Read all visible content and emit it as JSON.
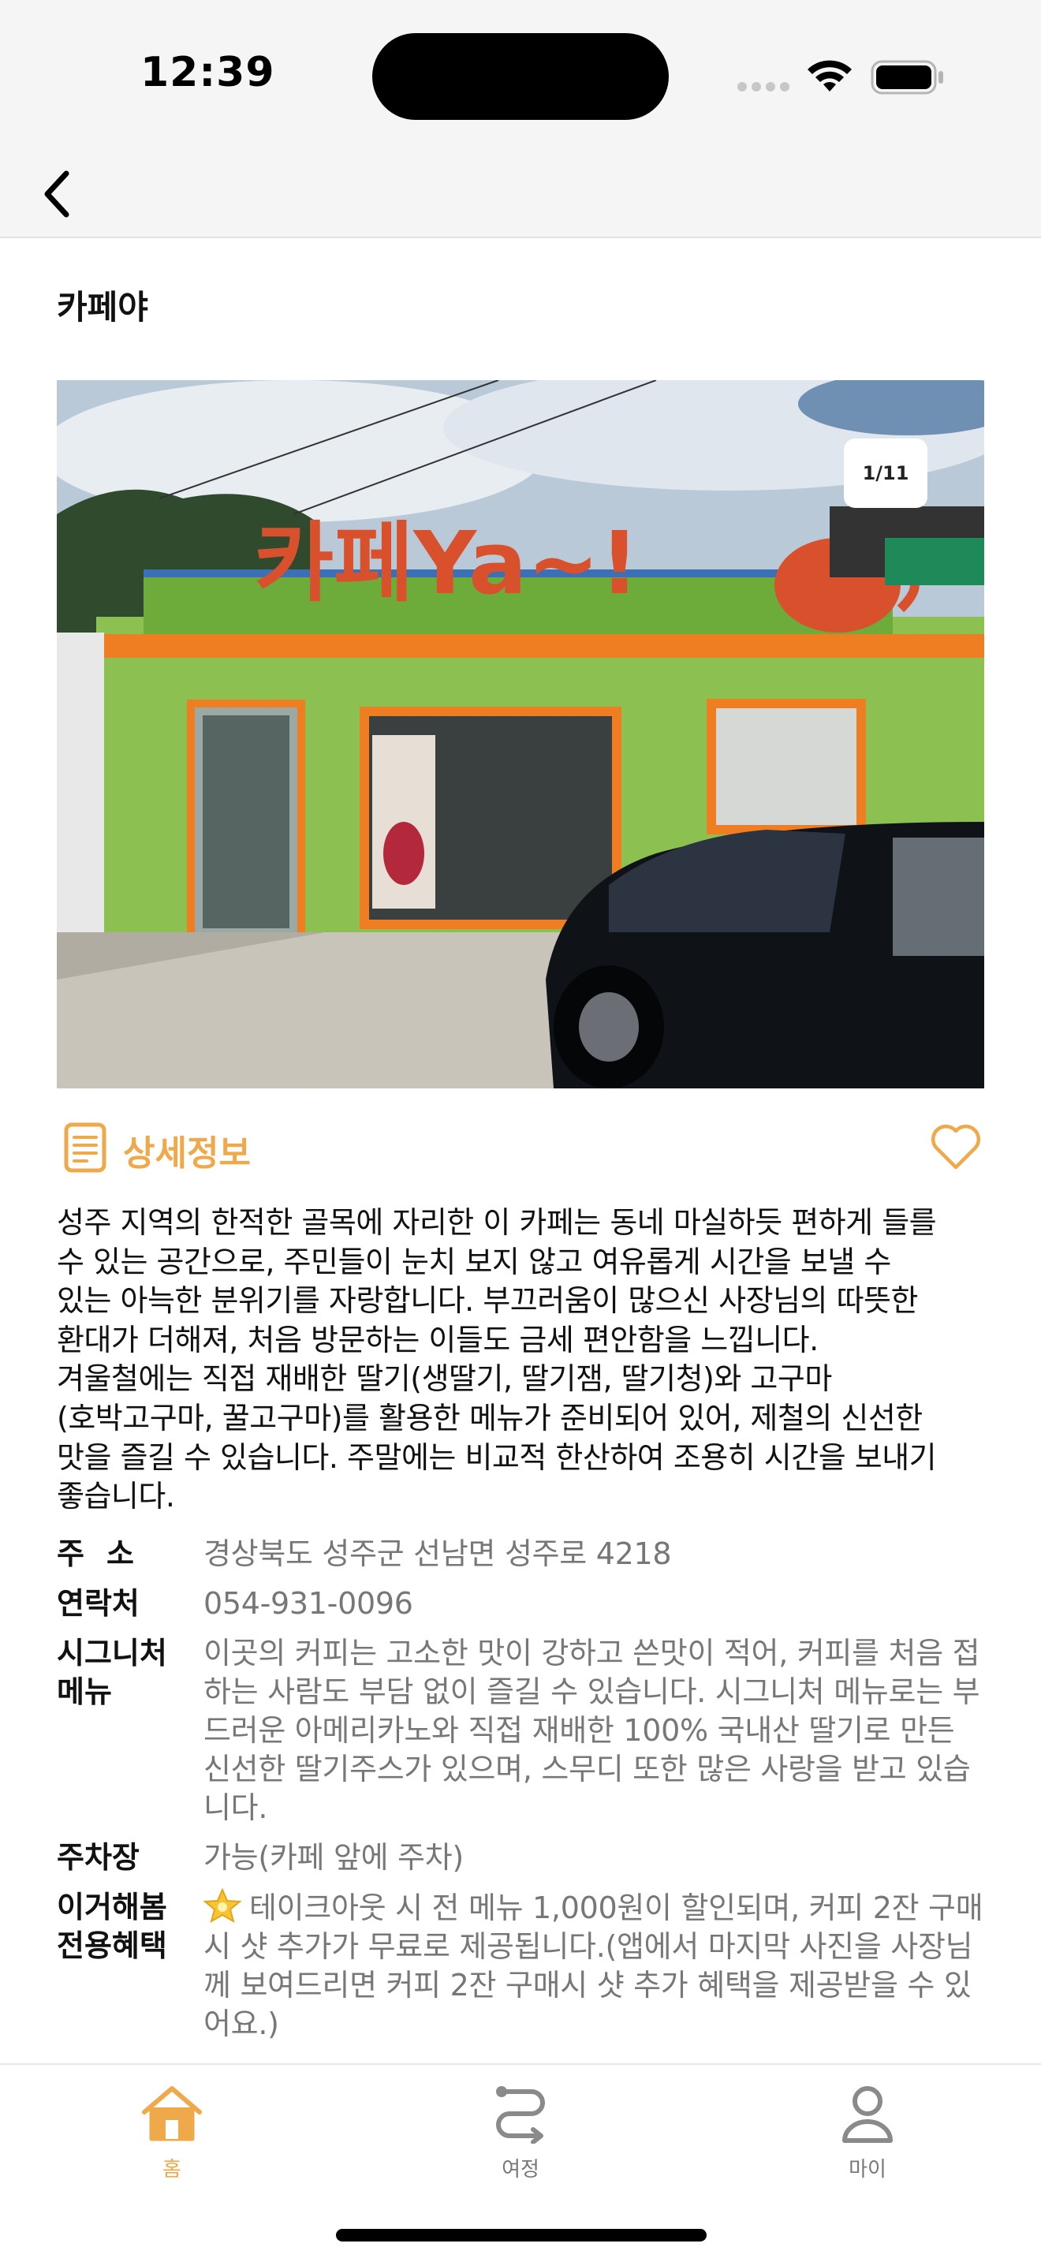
{
  "status_bar": {
    "time": "12:39"
  },
  "nav": {
    "back_icon": "chevron-left-icon"
  },
  "title": "카페야",
  "photo": {
    "counter": "1/11",
    "current": 1,
    "total": 11,
    "description": "Exterior of an orange and green cafe with a black car parked in front"
  },
  "detail": {
    "label": "상세정보",
    "icon": "document-list-icon",
    "favorite_icon": "heart-outline-icon"
  },
  "description": "성주 지역의 한적한 골목에 자리한 이 카페는 동네 마실하듯 편하게 들를\n수 있는 공간으로, 주민들이 눈치 보지 않고 여유롭게 시간을 보낼 수\n있는 아늑한 분위기를 자랑합니다. 부끄러움이 많으신 사장님의 따뜻한\n환대가 더해져, 처음 방문하는 이들도 금세 편안함을 느낍니다.\n겨울철에는 직접 재배한 딸기(생딸기, 딸기잼, 딸기청)와 고구마\n(호박고구마, 꿀고구마)를 활용한 메뉴가 준비되어 있어, 제철의 신선한\n맛을 즐길 수 있습니다. 주말에는 비교적 한산하여 조용히 시간을 보내기\n좋습니다.",
  "info": {
    "address_label": "주소",
    "address": "경상북도 성주군 선남면 성주로 4218",
    "contact_label": "연락처",
    "contact": "054-931-0096",
    "signature_label": "시그니처\n메뉴",
    "signature": "이곳의 커피는 고소한 맛이 강하고 쓴맛이 적어, 커피를 처음 접하는 사람도 부담 없이 즐길 수 있습니다. 시그니처 메뉴로는 부드러운 아메리카노와 직접 재배한 100% 국내산 딸기로 만든 신선한 딸기주스가 있으며, 스무디 또한 많은 사랑을 받고 있습니다.",
    "parking_label": "주차장",
    "parking": "가능(카페 앞에 주차)",
    "benefit_label": "이거해봄\n전용혜택",
    "benefit_icon": "sparkle-star-icon",
    "benefit": "테이크아웃 시 전 메뉴 1,000원이 할인되며, 커피 2잔 구매 시 샷 추가가 무료로 제공됩니다.(앱에서 마지막 사진을 사장님께 보여드리면 커피 2잔 구매시 샷 추가 혜택을 제공받을 수 있어요.)"
  },
  "tabs": [
    {
      "label": "홈",
      "icon": "home-icon",
      "active": true
    },
    {
      "label": "여정",
      "icon": "route-icon",
      "active": false
    },
    {
      "label": "마이",
      "icon": "person-icon",
      "active": false
    }
  ],
  "colors": {
    "accent": "#f0a94a",
    "muted_text": "#777777",
    "inactive_icon": "#8a8a8a"
  }
}
